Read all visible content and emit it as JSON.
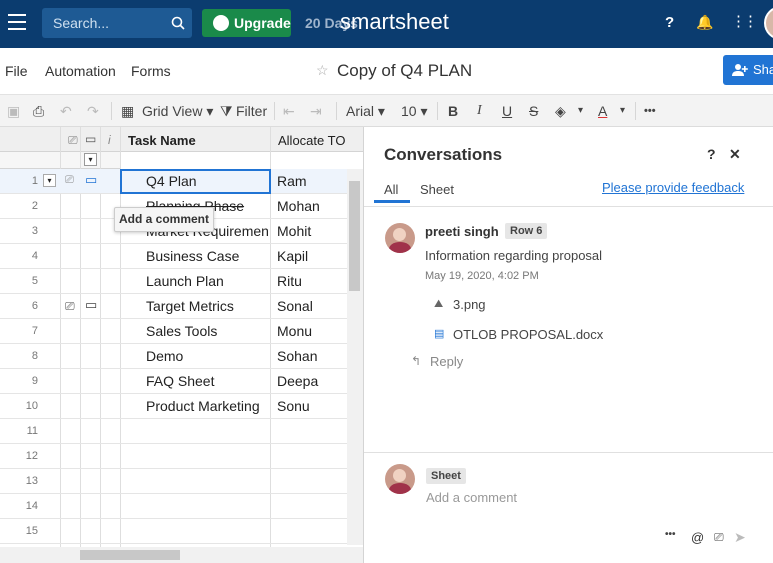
{
  "topbar": {
    "search_placeholder": "Search...",
    "upgrade_label": "Upgrade",
    "trial_text": "20 Days",
    "brand": "smartsheet",
    "help_glyph": "?",
    "bell_glyph": "🔔",
    "apps_glyph": "⋮⋮"
  },
  "menubar": {
    "items": [
      "File",
      "Automation",
      "Forms"
    ],
    "doc_title": "Copy of Q4 PLAN",
    "share_label": "Sha"
  },
  "toolbar": {
    "view_label": "Grid View",
    "filter_label": "Filter",
    "font_label": "Arial",
    "size_label": "10",
    "bold": "B",
    "italic": "I",
    "underline": "U",
    "strike": "S",
    "more": "•••"
  },
  "grid": {
    "columns": [
      "Task Name",
      "Allocate TO"
    ],
    "rows": [
      {
        "num": "1",
        "task": "Q4 Plan",
        "who": "Ram"
      },
      {
        "num": "2",
        "task": "Planning Phase",
        "who": "Mohan"
      },
      {
        "num": "3",
        "task": "Market Requirement",
        "who": "Mohit"
      },
      {
        "num": "4",
        "task": "Business Case",
        "who": "Kapil"
      },
      {
        "num": "5",
        "task": "Launch Plan",
        "who": "Ritu"
      },
      {
        "num": "6",
        "task": "Target Metrics",
        "who": "Sonal"
      },
      {
        "num": "7",
        "task": "Sales Tools",
        "who": "Monu"
      },
      {
        "num": "8",
        "task": "Demo",
        "who": "Sohan"
      },
      {
        "num": "9",
        "task": "FAQ Sheet",
        "who": "Deepa"
      },
      {
        "num": "10",
        "task": "Product Marketing",
        "who": "Sonu"
      },
      {
        "num": "11",
        "task": "",
        "who": ""
      },
      {
        "num": "12",
        "task": "",
        "who": ""
      },
      {
        "num": "13",
        "task": "",
        "who": ""
      },
      {
        "num": "14",
        "task": "",
        "who": ""
      },
      {
        "num": "15",
        "task": "",
        "who": ""
      }
    ],
    "tooltip": "Add a comment"
  },
  "conversations": {
    "title": "Conversations",
    "help": "?",
    "close": "✕",
    "tabs": [
      "All",
      "Sheet"
    ],
    "feedback_link": "Please provide feedback",
    "comment": {
      "author": "preeti singh",
      "row_badge": "Row 6",
      "text": "Information regarding proposal",
      "timestamp": "May 19, 2020, 4:02 PM",
      "attachments": [
        "3.png",
        "OTLOB PROPOSAL.docx"
      ],
      "reply_label": "Reply"
    },
    "composer": {
      "badge": "Sheet",
      "placeholder": "Add a comment"
    }
  }
}
